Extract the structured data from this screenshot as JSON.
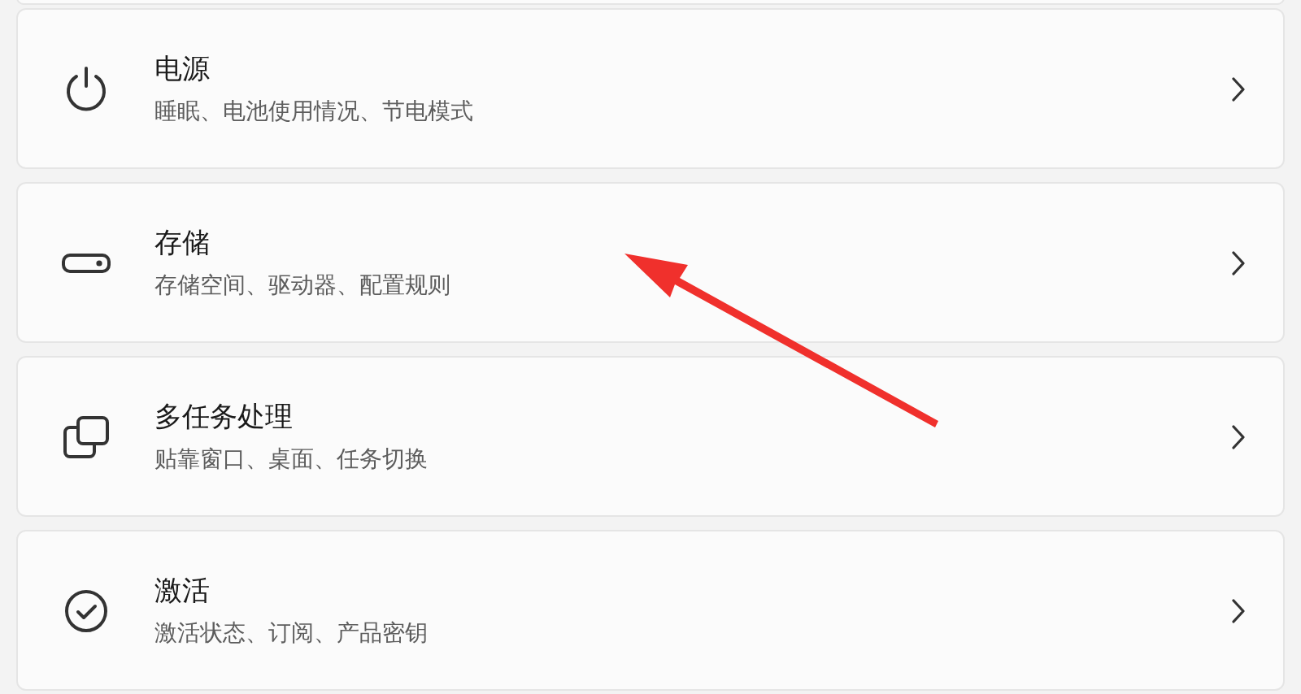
{
  "settings_items": [
    {
      "kind": "power",
      "title": "电源",
      "subtitle": "睡眠、电池使用情况、节电模式"
    },
    {
      "kind": "storage",
      "title": "存储",
      "subtitle": "存储空间、驱动器、配置规则"
    },
    {
      "kind": "multitasking",
      "title": "多任务处理",
      "subtitle": "贴靠窗口、桌面、任务切换"
    },
    {
      "kind": "activation",
      "title": "激活",
      "subtitle": "激活状态、订阅、产品密钥"
    }
  ]
}
